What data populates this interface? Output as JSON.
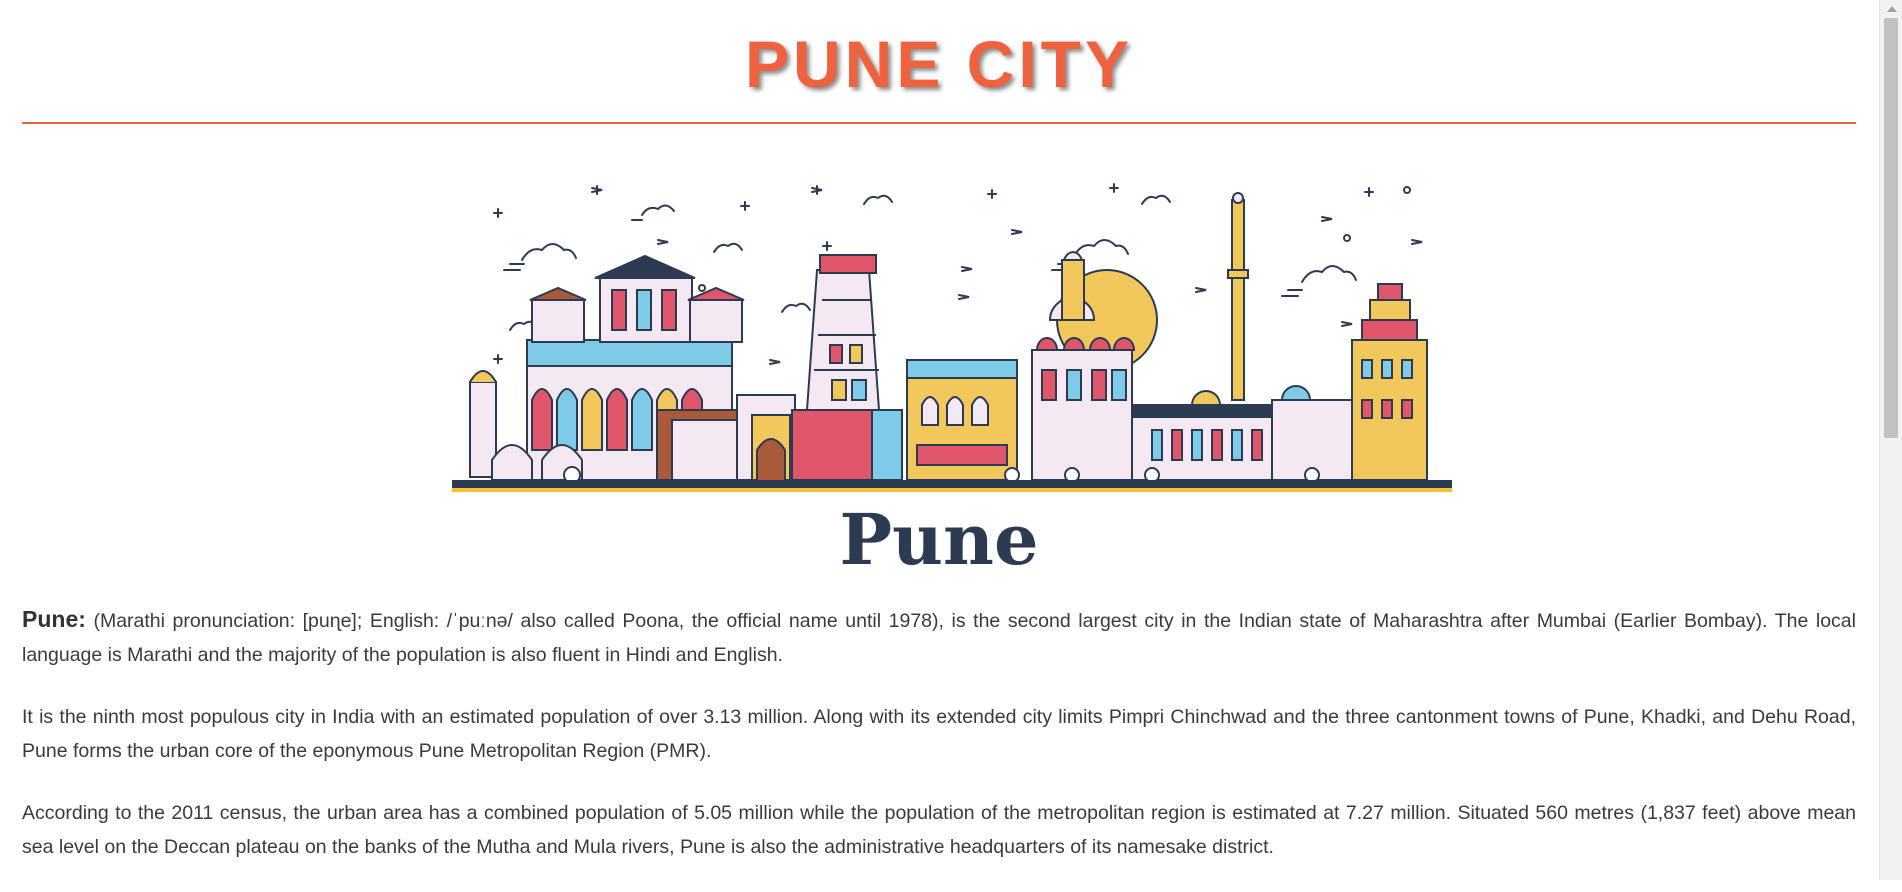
{
  "header": {
    "title": "PUNE CITY"
  },
  "illustration": {
    "wordmark": "Pune",
    "colors": {
      "outline": "#2c3b52",
      "red": "#e0566a",
      "yellow": "#f2c75b",
      "blue": "#7ecbe8",
      "brown": "#a85a3a",
      "pale": "#f4e9f2",
      "ground": "#f2c236"
    }
  },
  "article": {
    "p1_term": "Pune:",
    "p1_text": " (Marathi pronunciation: [puɳe]; English: /ˈpuːnə/ also called Poona, the official name until 1978), is the second largest city in the Indian state of Maharashtra after Mumbai (Earlier Bombay). The local language is Marathi and the majority of the population is also fluent in Hindi and English.",
    "p2": "It is the ninth most populous city in India with an estimated population of over 3.13 million. Along with its extended city limits Pimpri Chinchwad and the three cantonment towns of Pune, Khadki, and Dehu Road, Pune forms the urban core of the eponymous Pune Metropolitan Region (PMR).",
    "p3": "According to the 2011 census, the urban area has a combined population of 5.05 million while the population of the metropolitan region is estimated at 7.27 million. Situated 560 metres (1,837 feet) above mean sea level on the Deccan plateau on the banks of the Mutha and Mula rivers, Pune is also the administrative headquarters of its namesake district."
  },
  "colors": {
    "title": "#ee6240",
    "rule": "#e5633f",
    "text": "#3a3a3a"
  }
}
